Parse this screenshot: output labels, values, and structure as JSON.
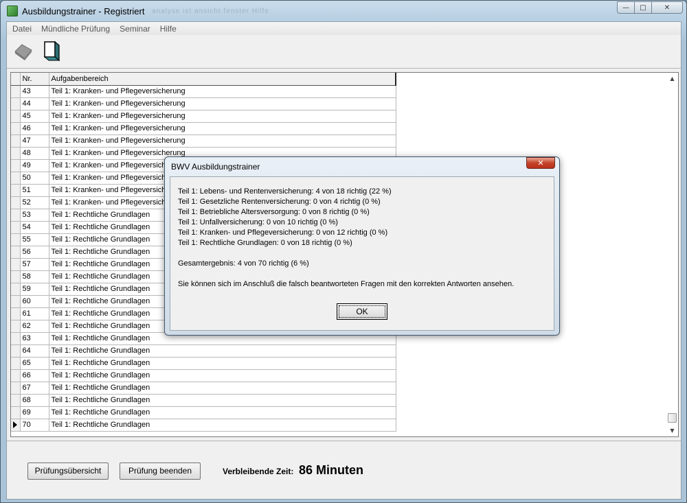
{
  "window": {
    "title": "Ausbildungstrainer - Registriert",
    "ghost_menu": "analyse    ist    ansicht    fenster    Hilfe"
  },
  "menu": {
    "items": [
      "Datei",
      "Mündliche Prüfung",
      "Seminar",
      "Hilfe"
    ]
  },
  "toolbar": {
    "icons": [
      "exit-icon",
      "open-folder-icon"
    ]
  },
  "grid": {
    "columns": [
      "Nr.",
      "Aufgabenbereich"
    ],
    "rows": [
      {
        "nr": "43",
        "area": "Teil 1: Kranken- und Pflegeversicherung"
      },
      {
        "nr": "44",
        "area": "Teil 1: Kranken- und Pflegeversicherung"
      },
      {
        "nr": "45",
        "area": "Teil 1: Kranken- und Pflegeversicherung"
      },
      {
        "nr": "46",
        "area": "Teil 1: Kranken- und Pflegeversicherung"
      },
      {
        "nr": "47",
        "area": "Teil 1: Kranken- und Pflegeversicherung"
      },
      {
        "nr": "48",
        "area": "Teil 1: Kranken- und Pflegeversicherung"
      },
      {
        "nr": "49",
        "area": "Teil 1: Kranken- und Pflegeversicherung"
      },
      {
        "nr": "50",
        "area": "Teil 1: Kranken- und Pflegeversicherung"
      },
      {
        "nr": "51",
        "area": "Teil 1: Kranken- und Pflegeversicherung"
      },
      {
        "nr": "52",
        "area": "Teil 1: Kranken- und Pflegeversicherung"
      },
      {
        "nr": "53",
        "area": "Teil 1: Rechtliche Grundlagen"
      },
      {
        "nr": "54",
        "area": "Teil 1: Rechtliche Grundlagen"
      },
      {
        "nr": "55",
        "area": "Teil 1: Rechtliche Grundlagen"
      },
      {
        "nr": "56",
        "area": "Teil 1: Rechtliche Grundlagen"
      },
      {
        "nr": "57",
        "area": "Teil 1: Rechtliche Grundlagen"
      },
      {
        "nr": "58",
        "area": "Teil 1: Rechtliche Grundlagen"
      },
      {
        "nr": "59",
        "area": "Teil 1: Rechtliche Grundlagen"
      },
      {
        "nr": "60",
        "area": "Teil 1: Rechtliche Grundlagen"
      },
      {
        "nr": "61",
        "area": "Teil 1: Rechtliche Grundlagen"
      },
      {
        "nr": "62",
        "area": "Teil 1: Rechtliche Grundlagen"
      },
      {
        "nr": "63",
        "area": "Teil 1: Rechtliche Grundlagen"
      },
      {
        "nr": "64",
        "area": "Teil 1: Rechtliche Grundlagen"
      },
      {
        "nr": "65",
        "area": "Teil 1: Rechtliche Grundlagen"
      },
      {
        "nr": "66",
        "area": "Teil 1: Rechtliche Grundlagen"
      },
      {
        "nr": "67",
        "area": "Teil 1: Rechtliche Grundlagen"
      },
      {
        "nr": "68",
        "area": "Teil 1: Rechtliche Grundlagen"
      },
      {
        "nr": "69",
        "area": "Teil 1: Rechtliche Grundlagen"
      },
      {
        "nr": "70",
        "area": "Teil 1: Rechtliche Grundlagen"
      }
    ],
    "current_row": "70"
  },
  "bottom": {
    "overview_button": "Prüfungsübersicht",
    "finish_button": "Prüfung beenden",
    "time_label": "Verbleibende Zeit:",
    "time_value": "86 Minuten"
  },
  "dialog": {
    "title": "BWV Ausbildungstrainer",
    "results": [
      "Teil 1: Lebens- und Rentenversicherung: 4 von 18 richtig (22 %)",
      "Teil 1: Gesetzliche Rentenversicherung: 0 von 4 richtig (0 %)",
      "Teil 1: Betriebliche Altersversorgung: 0 von 8 richtig (0 %)",
      "Teil 1: Unfallversicherung: 0 von 10 richtig (0 %)",
      "Teil 1: Kranken- und Pflegeversicherung: 0 von 12 richtig (0 %)",
      "Teil 1: Rechtliche Grundlagen: 0 von 18 richtig (0 %)"
    ],
    "total": "Gesamtergebnis: 4 von 70 richtig (6 %)",
    "note": "Sie können sich im Anschluß die falsch beantworteten Fragen mit den korrekten Antworten ansehen.",
    "ok_label": "OK"
  }
}
